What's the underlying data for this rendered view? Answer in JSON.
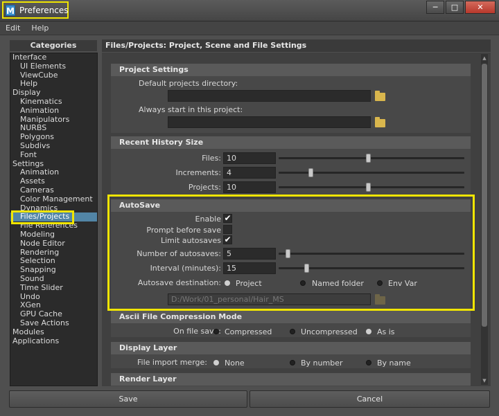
{
  "window": {
    "title": "Preferences",
    "app_icon": "M",
    "minimize_glyph": "─",
    "maximize_glyph": "□",
    "close_glyph": "✕"
  },
  "menu": [
    "Edit",
    "Help"
  ],
  "categories": {
    "header": "Categories",
    "items": [
      {
        "label": "Interface",
        "level": 0
      },
      {
        "label": "UI Elements",
        "level": 1
      },
      {
        "label": "ViewCube",
        "level": 1
      },
      {
        "label": "Help",
        "level": 1
      },
      {
        "label": "Display",
        "level": 0
      },
      {
        "label": "Kinematics",
        "level": 1
      },
      {
        "label": "Animation",
        "level": 1
      },
      {
        "label": "Manipulators",
        "level": 1
      },
      {
        "label": "NURBS",
        "level": 1
      },
      {
        "label": "Polygons",
        "level": 1
      },
      {
        "label": "Subdivs",
        "level": 1
      },
      {
        "label": "Font",
        "level": 1
      },
      {
        "label": "Settings",
        "level": 0
      },
      {
        "label": "Animation",
        "level": 1
      },
      {
        "label": "Assets",
        "level": 1
      },
      {
        "label": "Cameras",
        "level": 1
      },
      {
        "label": "Color Management",
        "level": 1
      },
      {
        "label": "Dynamics",
        "level": 1
      },
      {
        "label": "Files/Projects",
        "level": 1,
        "selected": true
      },
      {
        "label": "File References",
        "level": 1
      },
      {
        "label": "Modeling",
        "level": 1
      },
      {
        "label": "Node Editor",
        "level": 1
      },
      {
        "label": "Rendering",
        "level": 1
      },
      {
        "label": "Selection",
        "level": 1
      },
      {
        "label": "Snapping",
        "level": 1
      },
      {
        "label": "Sound",
        "level": 1
      },
      {
        "label": "Time Slider",
        "level": 1
      },
      {
        "label": "Undo",
        "level": 1
      },
      {
        "label": "XGen",
        "level": 1
      },
      {
        "label": "GPU Cache",
        "level": 1
      },
      {
        "label": "Save Actions",
        "level": 1
      },
      {
        "label": "Modules",
        "level": 0
      },
      {
        "label": "Applications",
        "level": 0
      }
    ]
  },
  "panel": {
    "header": "Files/Projects: Project, Scene and File Settings",
    "project_settings": {
      "title": "Project Settings",
      "default_dir_label": "Default projects directory:",
      "default_dir_value": "",
      "always_start_label": "Always start in this project:",
      "always_start_value": ""
    },
    "recent_history": {
      "title": "Recent History Size",
      "files_label": "Files:",
      "files_value": "10",
      "files_level": 0.48,
      "increments_label": "Increments:",
      "increments_value": "4",
      "increments_level": 0.17,
      "projects_label": "Projects:",
      "projects_value": "10",
      "projects_level": 0.48
    },
    "autosave": {
      "title": "AutoSave",
      "enable_label": "Enable",
      "enable_checked": true,
      "prompt_label": "Prompt before save",
      "prompt_checked": false,
      "limit_label": "Limit autosaves",
      "limit_checked": true,
      "number_label": "Number of autosaves:",
      "number_value": "5",
      "number_level": 0.05,
      "interval_label": "Interval (minutes):",
      "interval_value": "15",
      "interval_level": 0.15,
      "destination_label": "Autosave destination:",
      "destination_options": [
        "Project",
        "Named folder",
        "Env Var"
      ],
      "destination_selected": "Project",
      "path_value": "D:/Work/01_personal/Hair_MS"
    },
    "ascii": {
      "title": "Ascii File Compression Mode",
      "on_save_label": "On file save:",
      "options": [
        "Compressed",
        "Uncompressed",
        "As is"
      ],
      "selected": "As is"
    },
    "display_layer": {
      "title": "Display Layer",
      "merge_label": "File import merge:",
      "options": [
        "None",
        "By number",
        "By name"
      ],
      "selected": "None"
    },
    "render_layer": {
      "title": "Render Layer"
    }
  },
  "buttons": {
    "save": "Save",
    "cancel": "Cancel"
  },
  "colors": {
    "highlight": "#f0e500",
    "selection": "#5285a6",
    "folder": "#d9b64d"
  },
  "icons": {
    "folder": "folder-icon",
    "check": "✔"
  }
}
